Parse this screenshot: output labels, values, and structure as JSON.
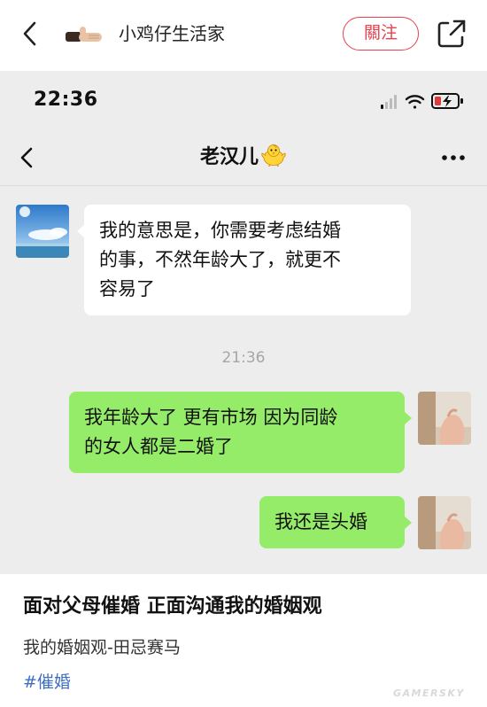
{
  "header": {
    "author_name": "小鸡仔生活家",
    "follow_label": "關注"
  },
  "chat": {
    "status_time": "22:36",
    "contact_name": "老汉儿",
    "messages": [
      {
        "side": "left",
        "text_lines": [
          "我的意思是，你需要考虑结婚",
          "的事，不然年龄大了，就更不",
          "容易了"
        ]
      },
      {
        "side": "right",
        "text_lines": [
          "我年龄大了 更有市场 因为同龄",
          "的女人都是二婚了"
        ]
      },
      {
        "side": "right",
        "text_lines": [
          "我还是头婚"
        ]
      }
    ],
    "timestamp": "21:36"
  },
  "post": {
    "title": "面对父母催婚 正面沟通我的婚姻观",
    "subtitle": "我的婚姻观-田忌赛马",
    "hashtag": "#催婚"
  },
  "watermark": "GAMERSKY",
  "colors": {
    "accent_red": "#e8414d",
    "bubble_green": "#95ec69",
    "chat_bg": "#ededed",
    "hashtag_blue": "#3f6fc0"
  },
  "icons": {
    "back": "chevron-left-icon",
    "share": "share-external-icon",
    "more": "more-dots-icon",
    "battery": "battery-charging-icon"
  }
}
